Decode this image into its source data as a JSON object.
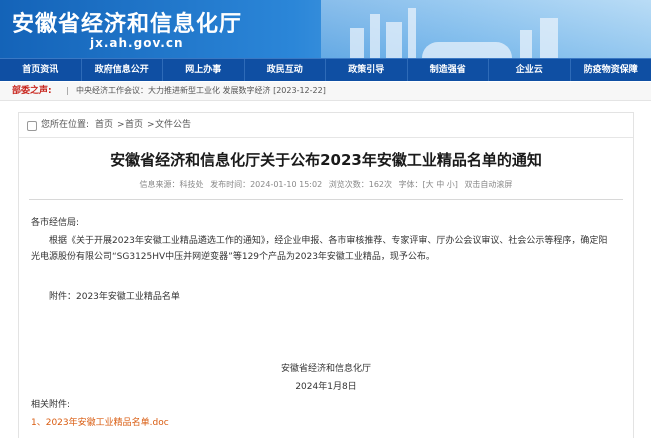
{
  "site": {
    "title": "安徽省经济和信息化厅",
    "domain": "jx.ah.gov.cn"
  },
  "nav": {
    "items": [
      "首页资讯",
      "政府信息公开",
      "网上办事",
      "政民互动",
      "政策引导",
      "制造强省",
      "企业云",
      "防疫物资保障"
    ]
  },
  "ticker": {
    "label": "部委之声:",
    "separator": "|",
    "text": "中央经济工作会议：大力推进新型工业化 发展数字经济 [2023-12-22]"
  },
  "breadcrumb": {
    "prefix": "您所在位置:",
    "items": [
      "首页",
      "首页",
      "文件公告"
    ]
  },
  "article": {
    "title": "安徽省经济和信息化厅关于公布2023年安徽工业精品名单的通知",
    "meta": {
      "source": "信息来源：科技处",
      "date": "发布时间：2024-01-10 15:02",
      "views": "浏览次数：162次",
      "font": "字体：[大 中 小]",
      "dblclick": "双击自动滚屏"
    },
    "salutation": "各市经信局:",
    "para1_line1": "根据《关于开展2023年安徽工业精品遴选工作的通知》，经企业申报、各市审核推荐、专家评审、厅办公会议审议、社会公示等程序，确定阳",
    "para1_line2": "光电源股份有限公司“SG3125HV中压并网逆变器”等129个产品为2023年安徽工业精品，现予公布。",
    "attachment": "附件：2023年安徽工业精品名单",
    "signature": "安徽省经济和信息化厅",
    "sign_date": "2024年1月8日",
    "related_label": "相关附件:",
    "related_link": "1、2023年安徽工业精品名单.doc"
  },
  "colors": {
    "nav_bg": "#0f4fa3",
    "accent": "#c8261e",
    "link": "#d95b0f"
  }
}
